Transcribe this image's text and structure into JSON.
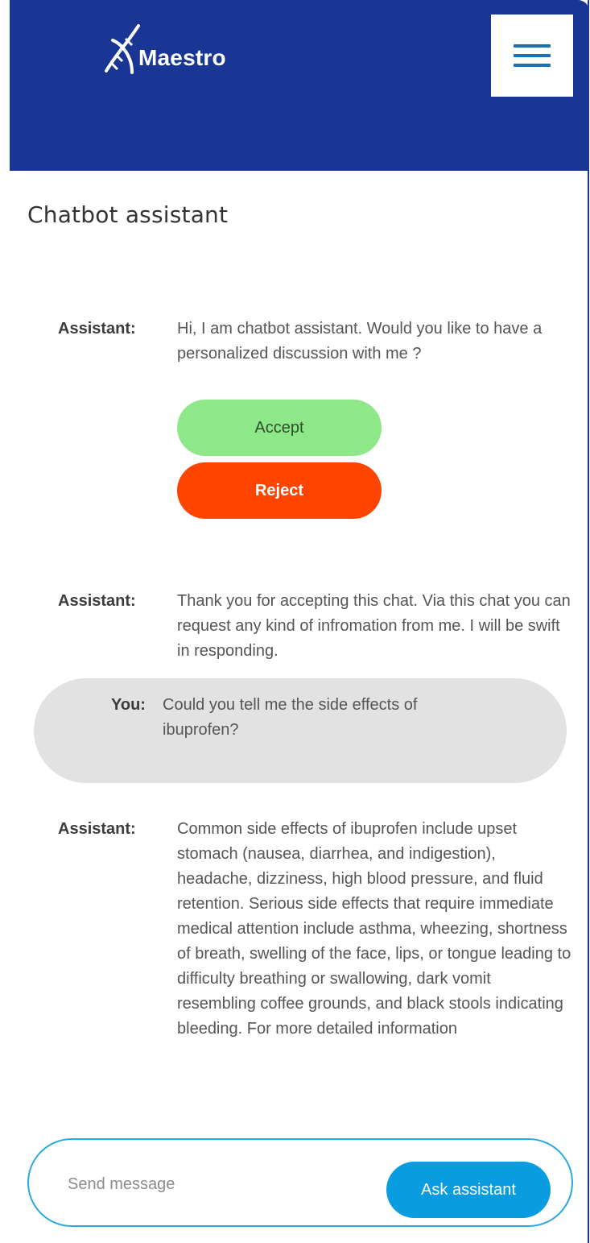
{
  "header": {
    "brand": "Maestro",
    "logo_icon": "dna-icon",
    "menu_icon": "hamburger-menu-icon",
    "background_color": "#1a3694"
  },
  "page": {
    "title": "Chatbot assistant"
  },
  "messages": [
    {
      "sender": "Assistant:",
      "text": "Hi, I am chatbot assistant. Would you like to have a personalized discussion with me ?"
    },
    {
      "sender": "Assistant:",
      "text": "Thank you for accepting this chat. Via this chat you can request any kind of infromation from me. I will be swift in responding."
    },
    {
      "sender": "You:",
      "text": "Could you tell me the side effects of ibuprofen?"
    },
    {
      "sender": "Assistant:",
      "text": "Common side effects of ibuprofen include upset stomach (nausea, diarrhea, and indigestion), headache, dizziness, high blood pressure, and fluid retention. Serious side effects that require immediate medical attention include asthma, wheezing, shortness of breath, swelling of the face, lips, or tongue leading to difficulty breathing or swallowing, dark vomit resembling coffee grounds, and black stools indicating bleeding. For more detailed information"
    }
  ],
  "consent": {
    "accept_label": "Accept",
    "reject_label": "Reject",
    "accept_color": "#8ee889",
    "reject_color": "#ff4400"
  },
  "composer": {
    "placeholder": "Send message",
    "value": "",
    "send_label": "Ask assistant",
    "accent_color": "#0a9ce0"
  }
}
